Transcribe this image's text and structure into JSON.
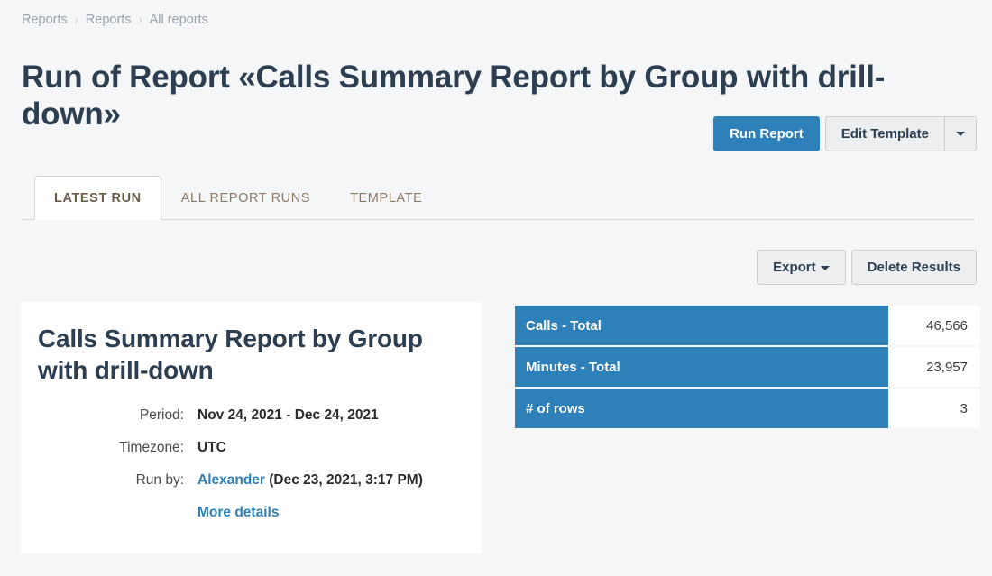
{
  "breadcrumb": {
    "items": [
      {
        "label": "Reports"
      },
      {
        "label": "Reports"
      },
      {
        "label": "All reports"
      }
    ],
    "separator": "›"
  },
  "page": {
    "title": "Run of Report «Calls Summary Report by Group with drill-down»"
  },
  "top_actions": {
    "run_report_label": "Run Report",
    "edit_template_label": "Edit Template",
    "dropdown_icon": "caret-down-icon"
  },
  "tabs": [
    {
      "label": "LATEST RUN",
      "active": true
    },
    {
      "label": "ALL REPORT RUNS",
      "active": false
    },
    {
      "label": "TEMPLATE",
      "active": false
    }
  ],
  "export_bar": {
    "export_label": "Export",
    "export_caret_icon": "caret-down-icon",
    "delete_results_label": "Delete Results"
  },
  "details": {
    "title": "Calls Summary Report by Group with drill-down",
    "period_label": "Period:",
    "period_value": "Nov 24, 2021 - Dec 24, 2021",
    "timezone_label": "Timezone:",
    "timezone_value": "UTC",
    "run_by_label": "Run by:",
    "run_by_user": "Alexander",
    "run_by_time": "(Dec 23, 2021, 3:17 PM)",
    "more_details_label": "More details"
  },
  "summary": {
    "rows": [
      {
        "label": "Calls - Total",
        "value": "46,566"
      },
      {
        "label": "Minutes - Total",
        "value": "23,957"
      },
      {
        "label": "# of rows",
        "value": "3"
      }
    ]
  },
  "colors": {
    "accent_blue": "#2e81b8",
    "title_navy": "#2c3e50",
    "page_bg": "#f5f6f8",
    "tab_text": "#8a7a63"
  }
}
